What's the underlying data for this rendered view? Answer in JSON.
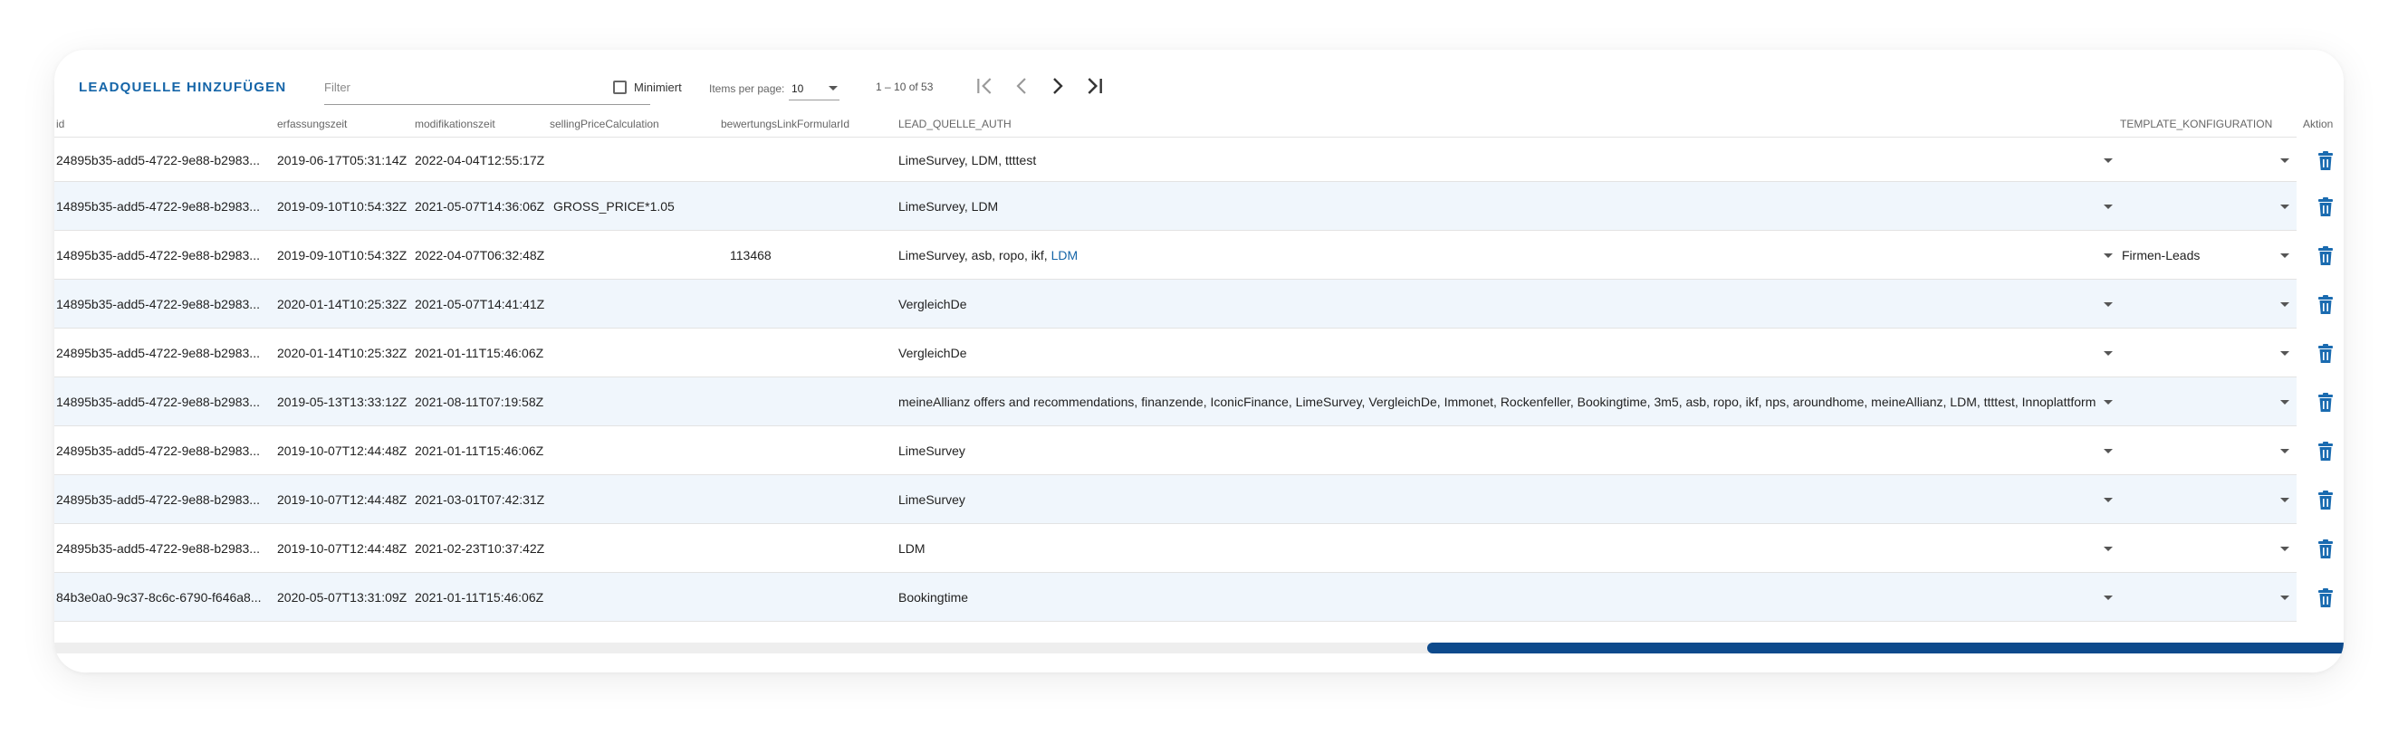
{
  "toolbar": {
    "add_label": "LEADQUELLE HINZUFÜGEN",
    "filter_placeholder": "Filter",
    "minimiert_label": "Minimiert",
    "items_per_page_label": "Items per page:",
    "items_per_page_value": "10",
    "range_label": "1 – 10 of 53"
  },
  "columns": {
    "id": "id",
    "erfassungszeit": "erfassungszeit",
    "modifikationszeit": "modifikationszeit",
    "sellingPriceCalculation": "sellingPriceCalculation",
    "bewertungsLinkFormularId": "bewertungsLinkFormularId",
    "lead_quelle_auth": "LEAD_QUELLE_AUTH",
    "template_konfiguration": "TEMPLATE_KONFIGURATION",
    "aktion": "Aktion"
  },
  "rows": [
    {
      "id": "24895b35-add5-4722-9e88-b2983...",
      "erfassungszeit": "2019-06-17T05:31:14Z",
      "modifikationszeit": "2022-04-04T12:55:17Z",
      "selling": "",
      "bewertung": "",
      "auth": "LimeSurvey, LDM, ttttest",
      "auth_hl": "",
      "template": ""
    },
    {
      "id": "14895b35-add5-4722-9e88-b2983...",
      "erfassungszeit": "2019-09-10T10:54:32Z",
      "modifikationszeit": "2021-05-07T14:36:06Z",
      "selling": "GROSS_PRICE*1.05",
      "bewertung": "",
      "auth": "LimeSurvey, LDM",
      "auth_hl": "",
      "template": ""
    },
    {
      "id": "14895b35-add5-4722-9e88-b2983...",
      "erfassungszeit": "2019-09-10T10:54:32Z",
      "modifikationszeit": "2022-04-07T06:32:48Z",
      "selling": "",
      "bewertung": "113468",
      "auth": "LimeSurvey, asb, ropo, ikf, ",
      "auth_hl": "LDM",
      "template": "Firmen-Leads"
    },
    {
      "id": "14895b35-add5-4722-9e88-b2983...",
      "erfassungszeit": "2020-01-14T10:25:32Z",
      "modifikationszeit": "2021-05-07T14:41:41Z",
      "selling": "",
      "bewertung": "",
      "auth": "VergleichDe",
      "auth_hl": "",
      "template": ""
    },
    {
      "id": "24895b35-add5-4722-9e88-b2983...",
      "erfassungszeit": "2020-01-14T10:25:32Z",
      "modifikationszeit": "2021-01-11T15:46:06Z",
      "selling": "",
      "bewertung": "",
      "auth": "VergleichDe",
      "auth_hl": "",
      "template": ""
    },
    {
      "id": "14895b35-add5-4722-9e88-b2983...",
      "erfassungszeit": "2019-05-13T13:33:12Z",
      "modifikationszeit": "2021-08-11T07:19:58Z",
      "selling": "",
      "bewertung": "",
      "auth": "meineAllianz offers and recommendations, finanzende, IconicFinance, LimeSurvey, VergleichDe, Immonet, Rockenfeller, Bookingtime, 3m5, asb, ropo, ikf, nps, aroundhome, meineAllianz, LDM, ttttest, Innoplattform",
      "auth_hl": "",
      "template": ""
    },
    {
      "id": "24895b35-add5-4722-9e88-b2983...",
      "erfassungszeit": "2019-10-07T12:44:48Z",
      "modifikationszeit": "2021-01-11T15:46:06Z",
      "selling": "",
      "bewertung": "",
      "auth": "LimeSurvey",
      "auth_hl": "",
      "template": ""
    },
    {
      "id": "24895b35-add5-4722-9e88-b2983...",
      "erfassungszeit": "2019-10-07T12:44:48Z",
      "modifikationszeit": "2021-03-01T07:42:31Z",
      "selling": "",
      "bewertung": "",
      "auth": "LimeSurvey",
      "auth_hl": "",
      "template": ""
    },
    {
      "id": "24895b35-add5-4722-9e88-b2983...",
      "erfassungszeit": "2019-10-07T12:44:48Z",
      "modifikationszeit": "2021-02-23T10:37:42Z",
      "selling": "",
      "bewertung": "",
      "auth": "LDM",
      "auth_hl": "",
      "template": ""
    },
    {
      "id": "84b3e0a0-9c37-8c6c-6790-f646a8...",
      "erfassungszeit": "2020-05-07T13:31:09Z",
      "modifikationszeit": "2021-01-11T15:46:06Z",
      "selling": "",
      "bewertung": "",
      "auth": "Bookingtime",
      "auth_hl": "",
      "template": ""
    }
  ],
  "icons": {
    "first_page": "first-page-icon",
    "prev_page": "chevron-left-icon",
    "next_page": "chevron-right-icon",
    "last_page": "last-page-icon",
    "delete": "trash-icon",
    "dropdown": "chevron-down-icon"
  },
  "colors": {
    "accent": "#1565a8",
    "row_alt": "#f0f6fc",
    "scroll_thumb": "#0d4a8c",
    "trash": "#1a6bb0"
  }
}
